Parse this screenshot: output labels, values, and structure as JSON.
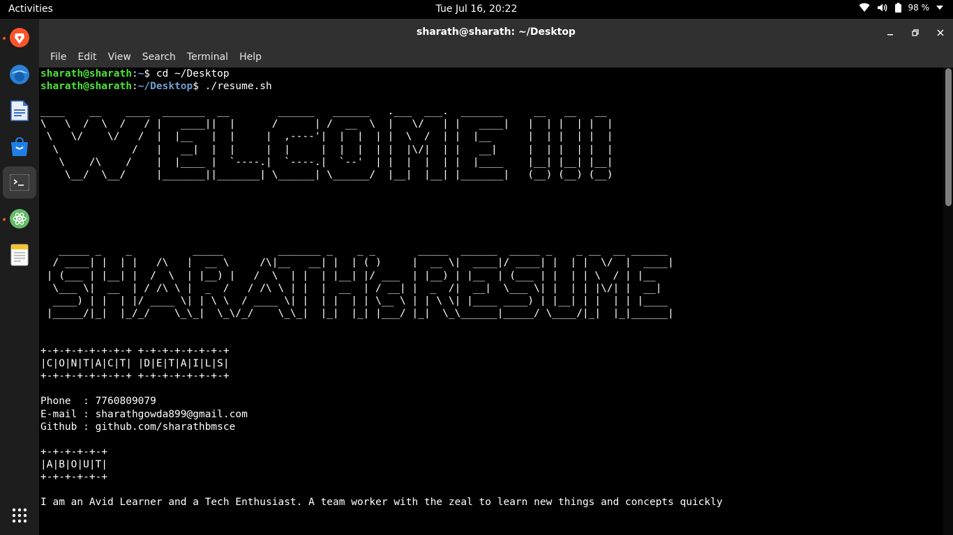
{
  "topbar": {
    "activities": "Activities",
    "clock": "Tue Jul 16, 20:22",
    "battery": "98 %"
  },
  "dock": {
    "items": [
      {
        "name": "brave-browser-icon",
        "color": "#fb542b"
      },
      {
        "name": "thunderbird-icon",
        "color": "#2a7fd4"
      },
      {
        "name": "libreoffice-writer-icon",
        "color": "#3b6fc9"
      },
      {
        "name": "app-center-icon",
        "color": "#1f7fe5"
      },
      {
        "name": "terminal-icon",
        "color": "#3d3d3d"
      },
      {
        "name": "atom-editor-icon",
        "color": "#66bb6a"
      },
      {
        "name": "text-editor-icon",
        "color": "#f4c430"
      },
      {
        "name": "app-grid-icon",
        "color": "#ffffff"
      }
    ]
  },
  "window": {
    "title": "sharath@sharath: ~/Desktop",
    "menu": [
      "File",
      "Edit",
      "View",
      "Search",
      "Terminal",
      "Help"
    ]
  },
  "terminal": {
    "prompt_user": "sharath@sharath",
    "prompts": [
      {
        "path": "~",
        "command": " cd ~/Desktop"
      },
      {
        "path": "~/Desktop",
        "command": " ./resume.sh"
      }
    ],
    "welcome_art": [
      "____    __    ____  _______  __        ______   ______   .___  ___.  _______     __   __   __  ",
      "\\   \\  /  \\  /   / |   ____||  |      /      | /  __  \\  |   \\/   | |   ____|   |  | |  | |  | ",
      " \\   \\/    \\/   /  |  |__   |  |     |  ,----'|  |  |  | |  \\  /  | |  |__      |  | |  | |  | ",
      "  \\            /   |   __|  |  |     |  |     |  |  |  | |  |\\/|  | |   __|     |  | |  | |  | ",
      "   \\    /\\    /    |  |____ |  `----.|  `----.|  `--'  | |  |  |  | |  |____    |__| |__| |__| ",
      "    \\__/  \\__/     |_______||_______| \\______| \\______/  |__|  |__| |_______|   (__) (__) (__) "
    ],
    "resume_art": [
      "   _____ _    _          _____         _______ _    _ _       _____  ______  _____ _    _ __  __ ______ ",
      "  / ____| |  | |   /\\   |  __ \\     /\\|__   __| |  | ( )     |  __ \\|  ____|/ ____| |  | |  \\/  |  ____|",
      " | (___ | |__| |  /  \\  | |__) |   /  \\  | |  | |__| |/ ___  | |__) | |__  | (___ | |  | | \\  / | |__   ",
      "  \\___ \\|  __  | / /\\ \\ |  _  /   / /\\ \\ | |  |  __  | / __| |  _  /|  __|  \\___ \\| |  | | |\\/| |  __|  ",
      "  ____) | |  | |/ ____ \\| | \\ \\  / ____ \\| |  | |  | | \\__ \\ | | \\ \\| |____ ____) | |__| | |  | | |____ ",
      " |_____/|_|  |_/_/    \\_\\_|  \\_\\/_/    \\_\\_|  |_|  |_| |___/ |_|  \\_\\______|_____/ \\____/|_|  |_|______|"
    ],
    "contact_box": [
      "+-+-+-+-+-+-+-+ +-+-+-+-+-+-+-+",
      "|C|O|N|T|A|C|T| |D|E|T|A|I|L|S|",
      "+-+-+-+-+-+-+-+ +-+-+-+-+-+-+-+"
    ],
    "contact": [
      "Phone  : 7760809079",
      "E-mail : sharathgowda899@gmail.com",
      "Github : github.com/sharathbmsce"
    ],
    "about_box": [
      "+-+-+-+-+-+",
      "|A|B|O|U|T|",
      "+-+-+-+-+-+"
    ],
    "about": "I am an Avid Learner and a Tech Enthusiast. A team worker with the zeal to learn new things and concepts quickly"
  }
}
